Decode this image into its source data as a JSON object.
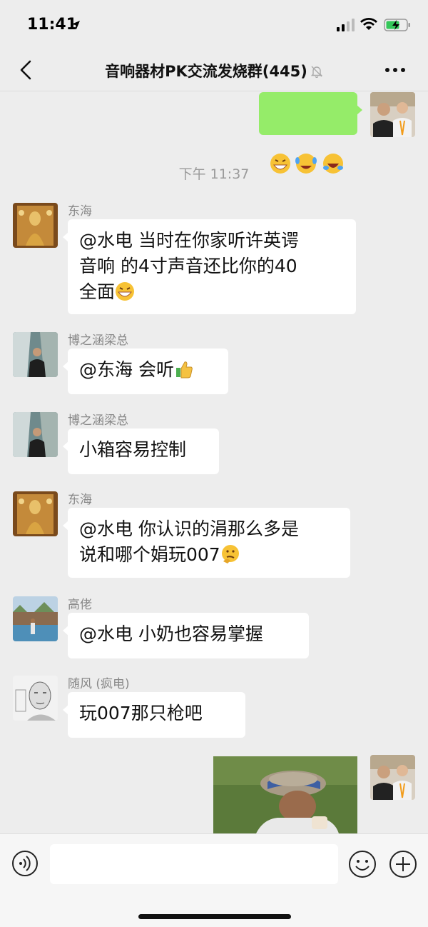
{
  "status_bar": {
    "time": "11:41",
    "battery_color": "#34c759"
  },
  "nav": {
    "title": "音响器材PK交流发烧群(445)"
  },
  "messages": [
    {
      "type": "self_emoji",
      "avatar": "avatar-self"
    },
    {
      "type": "time",
      "text": "下午 11:37"
    },
    {
      "type": "received",
      "sender": "东海",
      "text": "@水电 当时在你家听许英谔\n音响 的4寸声音还比你的40\n全面",
      "trailing_emoji": "grinning-face"
    },
    {
      "type": "received",
      "sender": "博之涵梁总",
      "text": "@东海 会听",
      "trailing_emoji": "thumbs-up"
    },
    {
      "type": "received",
      "sender": "博之涵梁总",
      "text": "小箱容易控制"
    },
    {
      "type": "received",
      "sender": "东海",
      "text": "@水电 你认识的涓那么多是\n说和哪个娟玩007",
      "trailing_emoji": "thinking-face"
    },
    {
      "type": "received",
      "sender": "高佬",
      "text": "@水电 小奶也容易掌握"
    },
    {
      "type": "received",
      "sender": "随风 (疯电)",
      "text": "玩007那只枪吧"
    },
    {
      "type": "self_image",
      "avatar": "avatar-self"
    }
  ],
  "input": {
    "placeholder": ""
  },
  "colors": {
    "background": "#ededed",
    "self_bubble": "#95ec69",
    "other_bubble": "#ffffff"
  }
}
